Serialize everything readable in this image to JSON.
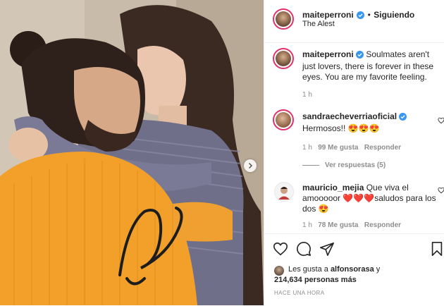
{
  "post": {
    "author": "maiteperroni",
    "follow_status": "Siguiendo",
    "location": "The Alest",
    "caption": {
      "username": "maiteperroni",
      "text": "Soulmates aren't just lovers, there is forever in these eyes. You are my favorite feeling.",
      "time": "1 h"
    },
    "comments": [
      {
        "username": "sandraecheverriaoficial",
        "text": "Hermosos!! 😍😍😍",
        "time": "1 h",
        "likes": "99 Me gusta",
        "reply": "Responder",
        "view_replies": "Ver respuestas (5)"
      },
      {
        "username": "mauricio_mejia",
        "text": "Que viva el amooooor ❤️❤️❤️saludos para los dos 😍",
        "time": "1 h",
        "likes": "78 Me gusta",
        "reply": "Responder"
      }
    ],
    "likes_line1_prefix": "Les gusta a ",
    "likes_user": "alfonsorasa",
    "likes_line1_suffix": " y",
    "likes_count": "214,634 personas más",
    "time_ago": "HACE UNA HORA"
  },
  "colors": {
    "verified": "#3897f0",
    "border": "#efefef",
    "muted": "#8e8e8e",
    "story_ring": "#e1306c",
    "sweater": "#f2a02a"
  },
  "icons": {
    "like": "heart-icon",
    "comment": "comment-icon",
    "share": "paper-plane-icon",
    "save": "bookmark-icon",
    "next": "chevron-right-icon"
  }
}
